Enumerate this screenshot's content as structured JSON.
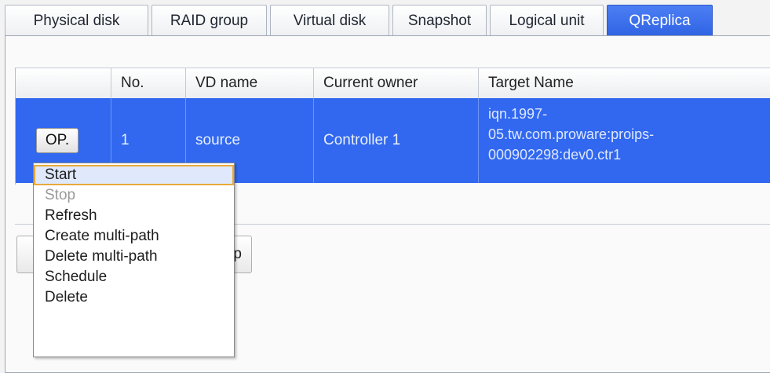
{
  "tabs": [
    "Physical disk",
    "RAID group",
    "Virtual disk",
    "Snapshot",
    "Logical unit",
    "QReplica"
  ],
  "active_tab": "QReplica",
  "table": {
    "headers": [
      "",
      "No.",
      "VD name",
      "Current owner",
      "Target Name"
    ],
    "rows": [
      {
        "op_label": "OP.",
        "no": "1",
        "vd_name": "source",
        "current_owner": "Controller 1",
        "target_name_lines": [
          "iqn.1997-",
          "05.tw.com.proware:proips-",
          "000902298:dev0.ctr1"
        ]
      }
    ]
  },
  "context_menu": {
    "items": [
      {
        "label": "Start",
        "state": "highlighted"
      },
      {
        "label": "Stop",
        "state": "disabled"
      },
      {
        "label": "Refresh",
        "state": "enabled"
      },
      {
        "label": "Create multi-path",
        "state": "enabled"
      },
      {
        "label": "Delete multi-path",
        "state": "enabled"
      },
      {
        "label": "Schedule",
        "state": "enabled"
      },
      {
        "label": "Delete",
        "state": "enabled"
      }
    ]
  },
  "obscured_button_label": "p",
  "colors": {
    "accent": "#3168ef",
    "active_tab": "#3b71ec",
    "menu_highlight_border": "#e8a93b",
    "menu_highlight_bg": "#dfe9fb"
  }
}
